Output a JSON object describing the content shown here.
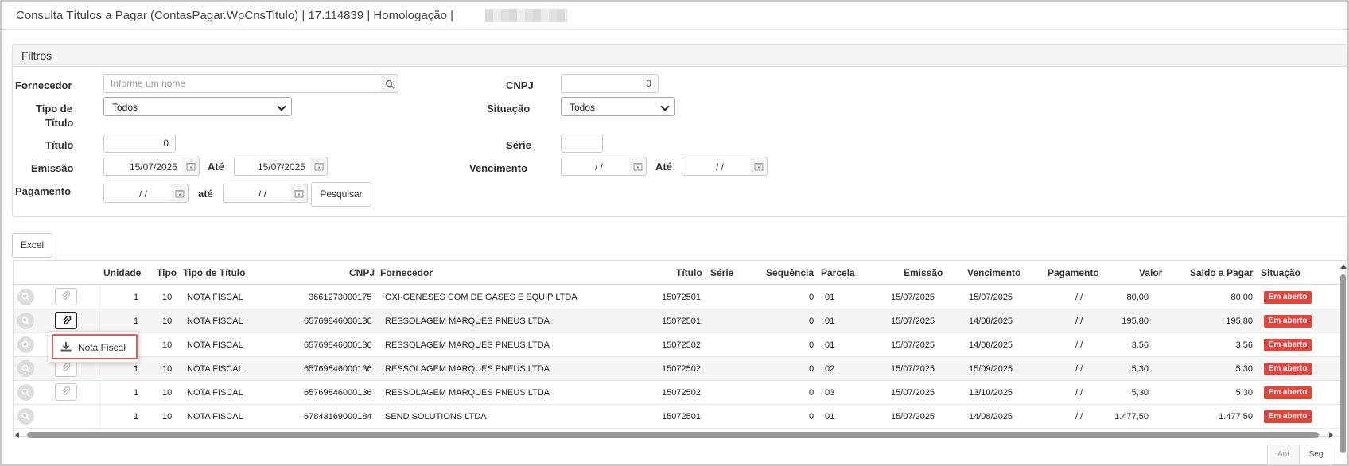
{
  "window": {
    "title": "Consulta Títulos a Pagar (ContasPagar.WpCnsTitulo) | 17.114839 | Homologação |"
  },
  "filters": {
    "panel_title": "Filtros",
    "fornecedor_label": "Fornecedor",
    "fornecedor_placeholder": "Informe um nome",
    "cnpj_label": "CNPJ",
    "cnpj_value": "0",
    "tipo_titulo_label_1": "Tipo de",
    "tipo_titulo_label_2": "Título",
    "tipo_titulo_value": "Todos",
    "situacao_label": "Situação",
    "situacao_value": "Todos",
    "titulo_label": "Título",
    "titulo_value": "0",
    "serie_label": "Série",
    "serie_value": "",
    "emissao_label": "Emissão",
    "emissao_from": "15/07/2025",
    "ate_label": "Até",
    "emissao_to": "15/07/2025",
    "vencimento_label": "Vencimento",
    "vencimento_from": " /  /",
    "vencimento_ate_label": "Até",
    "vencimento_to": " /  /",
    "pagamento_label": "Pagamento",
    "pagamento_from": " /  /",
    "pagamento_ate_label": "até",
    "pagamento_to": " /  /",
    "search_button": "Pesquisar"
  },
  "toolbar": {
    "excel_button": "Excel"
  },
  "grid": {
    "columns": [
      "Unidade",
      "Tipo",
      "Tipo de Título",
      "CNPJ",
      "Fornecedor",
      "Título",
      "Série",
      "Sequência",
      "Parcela",
      "Emissão",
      "Vencimento",
      "Pagamento",
      "Valor",
      "Saldo a Pagar",
      "Situação"
    ],
    "rows": [
      {
        "unidade": "1",
        "tipo": "10",
        "tipo_titulo": "NOTA FISCAL",
        "cnpj": "3661273000175",
        "fornecedor": "OXI-GENESES COM DE GASES E EQUIP LTDA",
        "titulo": "15072501",
        "serie": "",
        "sequencia": "0",
        "parcela": "01",
        "emissao": "15/07/2025",
        "vencimento": "15/07/2025",
        "pagamento": "/ /",
        "valor": "80,00",
        "saldo": "80,00",
        "situacao": "Em aberto"
      },
      {
        "unidade": "1",
        "tipo": "10",
        "tipo_titulo": "NOTA FISCAL",
        "cnpj": "65769846000136",
        "fornecedor": "RESSOLAGEM MARQUES PNEUS LTDA",
        "titulo": "15072501",
        "serie": "",
        "sequencia": "0",
        "parcela": "01",
        "emissao": "15/07/2025",
        "vencimento": "14/08/2025",
        "pagamento": "/ /",
        "valor": "195,80",
        "saldo": "195,80",
        "situacao": "Em aberto"
      },
      {
        "unidade": "1",
        "tipo": "10",
        "tipo_titulo": "NOTA FISCAL",
        "cnpj": "65769846000136",
        "fornecedor": "RESSOLAGEM MARQUES PNEUS LTDA",
        "titulo": "15072502",
        "serie": "",
        "sequencia": "0",
        "parcela": "01",
        "emissao": "15/07/2025",
        "vencimento": "14/08/2025",
        "pagamento": "/ /",
        "valor": "3,56",
        "saldo": "3,56",
        "situacao": "Em aberto"
      },
      {
        "unidade": "1",
        "tipo": "10",
        "tipo_titulo": "NOTA FISCAL",
        "cnpj": "65769846000136",
        "fornecedor": "RESSOLAGEM MARQUES PNEUS LTDA",
        "titulo": "15072502",
        "serie": "",
        "sequencia": "0",
        "parcela": "02",
        "emissao": "15/07/2025",
        "vencimento": "15/09/2025",
        "pagamento": "/ /",
        "valor": "5,30",
        "saldo": "5,30",
        "situacao": "Em aberto"
      },
      {
        "unidade": "1",
        "tipo": "10",
        "tipo_titulo": "NOTA FISCAL",
        "cnpj": "65769846000136",
        "fornecedor": "RESSOLAGEM MARQUES PNEUS LTDA",
        "titulo": "15072502",
        "serie": "",
        "sequencia": "0",
        "parcela": "03",
        "emissao": "15/07/2025",
        "vencimento": "13/10/2025",
        "pagamento": "/ /",
        "valor": "5,30",
        "saldo": "5,30",
        "situacao": "Em aberto"
      },
      {
        "unidade": "1",
        "tipo": "10",
        "tipo_titulo": "NOTA FISCAL",
        "cnpj": "67843169000184",
        "fornecedor": "SEND SOLUTIONS LTDA",
        "titulo": "15072501",
        "serie": "",
        "sequencia": "0",
        "parcela": "01",
        "emissao": "15/07/2025",
        "vencimento": "14/08/2025",
        "pagamento": "/ /",
        "valor": "1.477,50",
        "saldo": "1.477,50",
        "situacao": "Em aberto"
      }
    ]
  },
  "popup": {
    "item_label": "Nota Fiscal",
    "icon": "download-icon"
  },
  "pager": {
    "prev": "Ant",
    "next": "Seg"
  },
  "colors": {
    "badge": "#e2453c",
    "popup_border": "#e06060"
  }
}
